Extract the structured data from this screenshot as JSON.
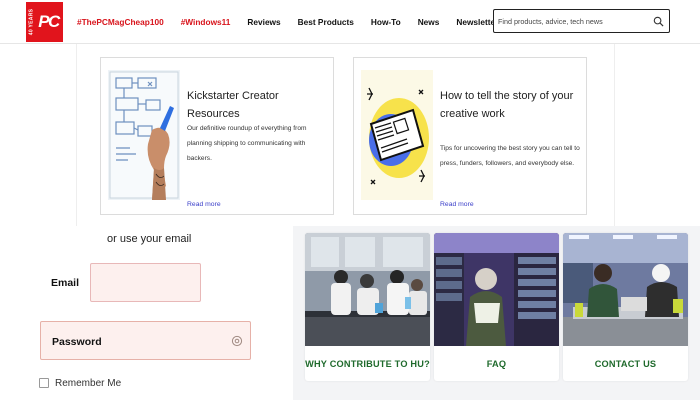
{
  "header": {
    "logo": {
      "side_text": "40 YEARS",
      "mark": "PC"
    },
    "nav": [
      {
        "label": "#ThePCMagCheap100",
        "tag": true
      },
      {
        "label": "#Windows11",
        "tag": true
      },
      {
        "label": "Reviews",
        "tag": false
      },
      {
        "label": "Best Products",
        "tag": false
      },
      {
        "label": "How-To",
        "tag": false
      },
      {
        "label": "News",
        "tag": false
      },
      {
        "label": "Newsletters",
        "tag": false
      }
    ],
    "search": {
      "placeholder": "Find products, advice, tech news",
      "icon": "search-icon"
    }
  },
  "cards": [
    {
      "title": "Kickstarter Creator Resources",
      "description": "Our definitive roundup of everything from planning shipping to communicating with backers.",
      "link": "Read more",
      "image": "whiteboard-planning-illustration"
    },
    {
      "title": "How to tell the story of your creative work",
      "description": "Tips for uncovering the best story you can tell to press, funders, followers, and everybody else.",
      "link": "Read more",
      "image": "newspaper-story-illustration"
    }
  ],
  "login": {
    "alt_text": "or use your email",
    "email_label": "Email",
    "email_value": "",
    "password_label": "Password",
    "eye_icon": "eye-icon",
    "remember_label": "Remember Me",
    "remember_checked": false
  },
  "tiles": [
    {
      "label": "WHY CONTRIBUTE TO HU?",
      "image": "lab-students-photo"
    },
    {
      "label": "FAQ",
      "image": "library-student-photo"
    },
    {
      "label": "CONTACT US",
      "image": "study-room-students-photo"
    }
  ],
  "colors": {
    "brand_red": "#e1141c",
    "tag_red": "#d8141c",
    "link_blue": "#3b3fc9",
    "tile_green": "#1f6a2c",
    "field_bg": "#fdf0ee"
  }
}
